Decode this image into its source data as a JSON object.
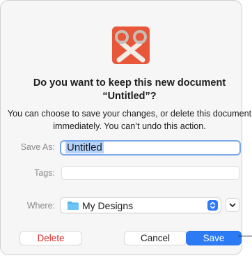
{
  "dialog": {
    "title": "Do you want to keep this new document “Untitled”?",
    "message": "You can choose to save your changes, or delete this document immediately. You can’t undo this action.",
    "app_icon": "scissors-app-icon"
  },
  "form": {
    "save_as_label": "Save As:",
    "save_as_value": "Untitled",
    "tags_label": "Tags:",
    "tags_value": "",
    "where_label": "Where:",
    "where_value": "My Designs",
    "where_icon": "folder-icon"
  },
  "buttons": {
    "delete": "Delete",
    "cancel": "Cancel",
    "save": "Save"
  },
  "colors": {
    "accent": "#2c7bf5",
    "destructive": "#e02a2a",
    "app_icon": "#e8573a"
  }
}
